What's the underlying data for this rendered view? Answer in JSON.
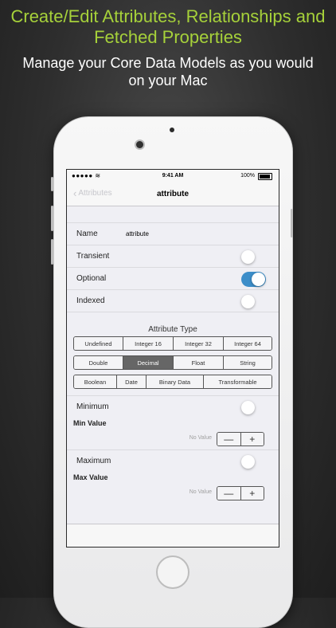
{
  "headline": "Create/Edit Attributes, Relationships and Fetched Properties",
  "subheadline": "Manage your Core Data Models as you would on your Mac",
  "status_bar": {
    "signal": "●●●●● ≋",
    "time": "9:41 AM",
    "battery": "100%"
  },
  "nav": {
    "back_label": "Attributes",
    "title": "attribute"
  },
  "fields": {
    "name_label": "Name",
    "name_value": "attribute",
    "transient_label": "Transient",
    "transient_on": false,
    "optional_label": "Optional",
    "optional_on": true,
    "indexed_label": "Indexed",
    "indexed_on": false
  },
  "attribute_type": {
    "title": "Attribute Type",
    "row1": [
      "Undefined",
      "Integer 16",
      "Integer 32",
      "Integer 64"
    ],
    "row2": [
      "Double",
      "Decimal",
      "Float",
      "String"
    ],
    "row3": [
      "Boolean",
      "Date",
      "Binary Data",
      "Transformable"
    ],
    "selected": "Decimal"
  },
  "minimum": {
    "label": "Minimum",
    "on": false,
    "value_label": "Min Value",
    "placeholder": "No Value"
  },
  "maximum": {
    "label": "Maximum",
    "on": false,
    "value_label": "Max Value",
    "placeholder": "No Value"
  },
  "stepper": {
    "minus": "—",
    "plus": "+"
  },
  "colors": {
    "headline": "#a6d13a",
    "toggle_on": "#3d8ec9",
    "selected_segment": "#666666"
  }
}
